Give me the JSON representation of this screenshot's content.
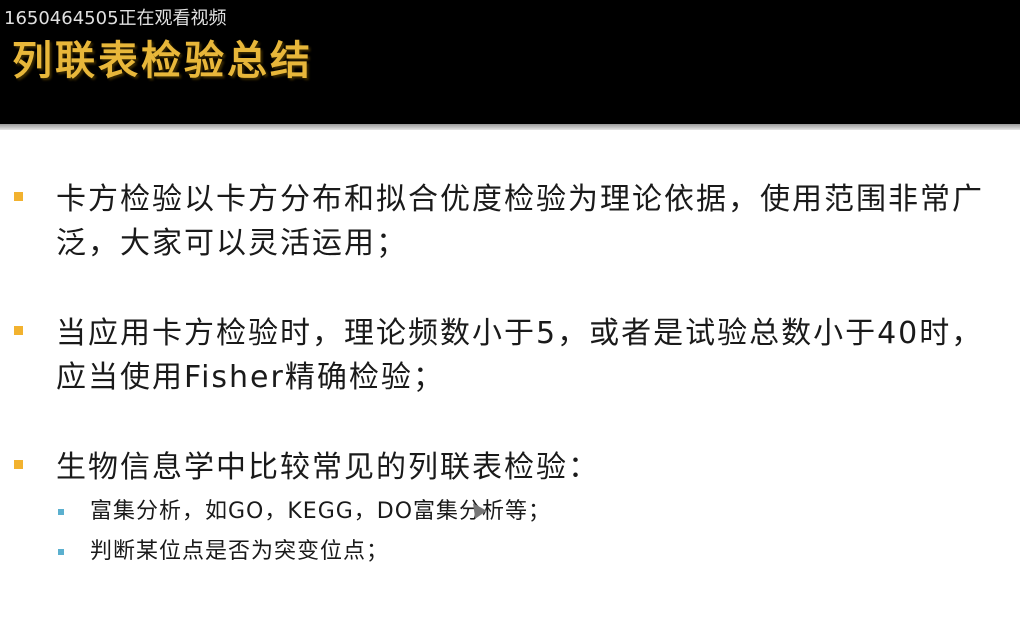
{
  "watermark": "1650464505正在观看视频",
  "title": "列联表检验总结",
  "bullets": [
    {
      "text": "卡方检验以卡方分布和拟合优度检验为理论依据，使用范围非常广泛，大家可以灵活运用；"
    },
    {
      "text": "当应用卡方检验时，理论频数小于5，或者是试验总数小于40时，应当使用Fisher精确检验；"
    },
    {
      "text": "生物信息学中比较常见的列联表检验："
    }
  ],
  "sub_bullets": [
    {
      "text": "富集分析，如GO，KEGG，DO富集分析等；"
    },
    {
      "text": "判断某位点是否为突变位点；"
    }
  ],
  "colors": {
    "header_bg": "#000000",
    "title": "#e8b73a",
    "bullet": "#f2b22f",
    "sub_bullet": "#5bb0cf"
  }
}
